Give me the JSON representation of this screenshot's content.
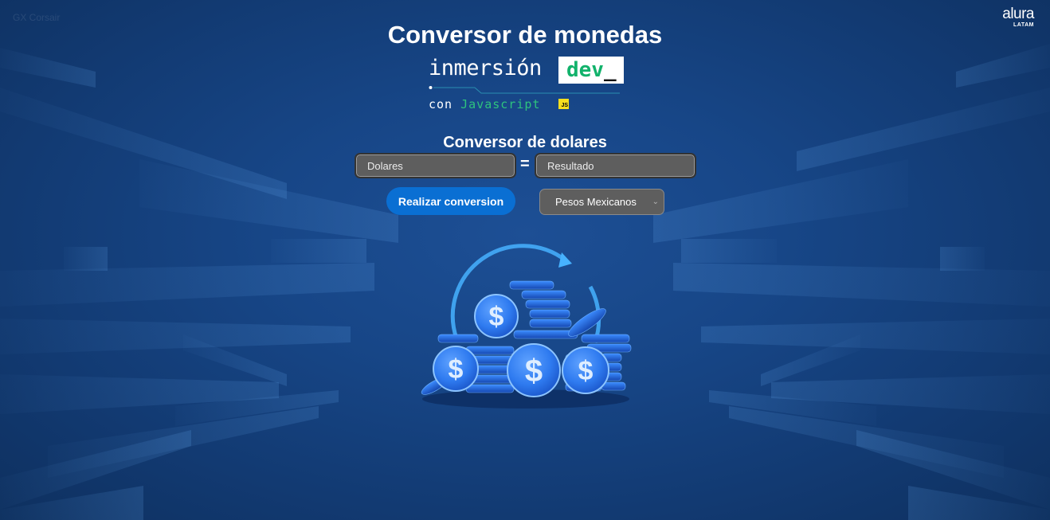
{
  "app": {
    "watermark": "GX Corsair"
  },
  "alura": {
    "name": "alura",
    "sub": "LATAM"
  },
  "header": {
    "title": "Conversor de monedas"
  },
  "brand": {
    "word": "inmersión",
    "dev_word": "dev",
    "dev_cursor": "_",
    "sub_prefix": "con",
    "sub_lang": "Javascript",
    "badge": "JS",
    "accent_green": "#12b26b"
  },
  "converter": {
    "title": "Conversor de dolares",
    "input_placeholder": "Dolares",
    "equals": "=",
    "result_placeholder": "Resultado",
    "button_label": "Realizar conversion",
    "currency_selected": "Pesos Mexicanos",
    "currency_icon": "chevron-down-icon",
    "button_color": "#0a6fd3",
    "field_color": "#5e5e5e"
  },
  "hero": {
    "icon": "coins-exchange-icon",
    "coin_symbol": "$",
    "coin_color": "#2f7bf0",
    "arrow_color": "#47b2ff"
  }
}
